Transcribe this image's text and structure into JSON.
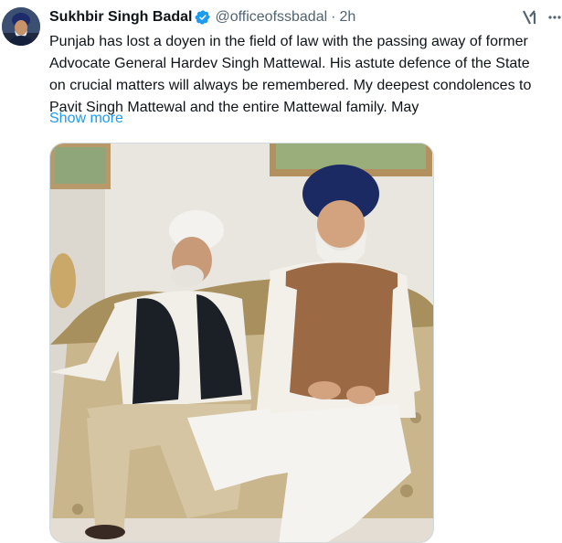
{
  "tweet": {
    "author_name": "Sukhbir Singh Badal",
    "handle": "@officeofssbadal",
    "separator": "·",
    "time": "2h",
    "text": "Punjab has lost a doyen in the field of law with the passing away of former\nAdvocate General Hardev Singh Mattewal.  His astute defence of the State\non crucial matters will always be remembered. My deepest condolences to\nPavit Singh Mattewal and the entire Mattewal family. May",
    "show_more_label": "Show more",
    "verified": true,
    "icons": {
      "verified": "verified-badge-icon",
      "grok": "grok-icon",
      "more": "more-options-icon"
    },
    "colors": {
      "link": "#1d9bf0",
      "secondary_text": "#536471",
      "primary_text": "#0f1419"
    }
  }
}
